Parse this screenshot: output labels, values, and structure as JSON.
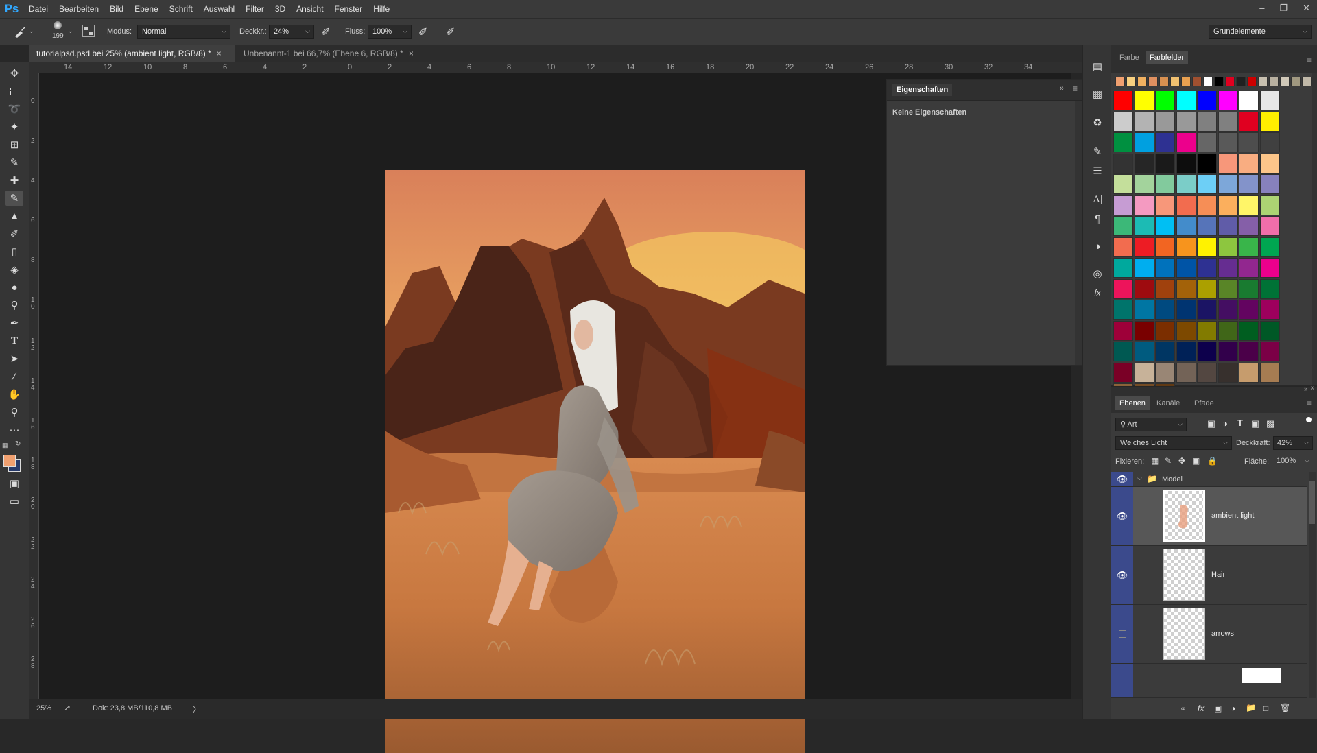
{
  "app": {
    "logo": "Ps"
  },
  "menu": [
    "Datei",
    "Bearbeiten",
    "Bild",
    "Ebene",
    "Schrift",
    "Auswahl",
    "Filter",
    "3D",
    "Ansicht",
    "Fenster",
    "Hilfe"
  ],
  "options": {
    "brush_size": "199",
    "mode_label": "Modus:",
    "mode_value": "Normal",
    "opacity_label": "Deckkr.:",
    "opacity_value": "24%",
    "flow_label": "Fluss:",
    "flow_value": "100%",
    "workspace": "Grundelemente"
  },
  "tabs": [
    {
      "label": "tutorialpsd.psd bei 25% (ambient light, RGB/8) *",
      "close": "×"
    },
    {
      "label": "Unbenannt-1 bei 66,7% (Ebene 6, RGB/8) *",
      "close": "×"
    }
  ],
  "ruler_h": [
    "14",
    "12",
    "10",
    "8",
    "6",
    "4",
    "2",
    "0",
    "2",
    "4",
    "6",
    "8",
    "10",
    "12",
    "14",
    "16",
    "18",
    "20",
    "22",
    "24",
    "26",
    "28",
    "30",
    "32",
    "34"
  ],
  "ruler_v": [
    "0",
    "2",
    "4",
    "6",
    "8",
    "10",
    "12",
    "14",
    "16",
    "18",
    "20",
    "22",
    "24",
    "26",
    "28"
  ],
  "status": {
    "zoom": "25%",
    "doc": "Dok: 23,8 MB/110,8 MB",
    "arrow": "〉"
  },
  "properties": {
    "title": "Eigenschaften",
    "empty": "Keine Eigenschaften"
  },
  "swatches": {
    "tab_color": "Farbe",
    "tab_swatches": "Farbfelder",
    "recent": [
      "#f0a070",
      "#f8d080",
      "#f0b060",
      "#e09060",
      "#d89050",
      "#f0c070",
      "#e8a050",
      "#a05030",
      "#ffffff",
      "#000000",
      "#e00020",
      "#202020",
      "#cc0000",
      "#c8c0b0",
      "#b8b0a0",
      "#d0c8b8",
      "#a09880",
      "#c0b8a8"
    ],
    "grid": [
      [
        "#ff0000",
        "#ffff00",
        "#00ff00",
        "#00ffff",
        "#0000ff",
        "#ff00ff",
        "#ffffff",
        "#e6e6e6"
      ],
      [
        "#cccccc",
        "#b3b3b3",
        "#999999",
        "#999999",
        "#808080",
        "#808080",
        "#e00020",
        "#ffee00"
      ],
      [
        "#009040",
        "#00a0e0",
        "#2e3192",
        "#ec008c",
        "#666666",
        "#595959",
        "#4d4d4d",
        "#404040"
      ],
      [
        "#333333",
        "#262626",
        "#1a1a1a",
        "#0d0d0d",
        "#000000",
        "#f7977a",
        "#f9ad81",
        "#fdc68a"
      ],
      [
        "#c4df9b",
        "#a3d39c",
        "#82ca9d",
        "#7bcdc8",
        "#6dcff6",
        "#7da7d9",
        "#8393ca",
        "#8781bd"
      ],
      [
        "#c69cd3",
        "#f49ac1",
        "#f7977a",
        "#f26c4f",
        "#f68e56",
        "#fbaf5d",
        "#fff568",
        "#acd373"
      ],
      [
        "#3cb878",
        "#1cbbb4",
        "#00bff3",
        "#438ccb",
        "#5674b9",
        "#605ca8",
        "#855fa8",
        "#f06eaa"
      ],
      [
        "#f26c4f",
        "#ed1c24",
        "#f26522",
        "#f7941d",
        "#fff200",
        "#8dc63f",
        "#39b54a",
        "#00a651"
      ],
      [
        "#00a99d",
        "#00aeef",
        "#0072bc",
        "#0054a6",
        "#2e3192",
        "#662d91",
        "#92278f",
        "#ec008c"
      ],
      [
        "#ed145b",
        "#9e0b0f",
        "#a0410d",
        "#a36209",
        "#aba000",
        "#598527",
        "#197b30",
        "#007236"
      ],
      [
        "#00746b",
        "#0076a3",
        "#004a80",
        "#003471",
        "#1b1464",
        "#440e62",
        "#630460",
        "#9e005d"
      ],
      [
        "#9e0039",
        "#790000",
        "#7b2e00",
        "#7d4900",
        "#827b00",
        "#406618",
        "#005e20",
        "#005826"
      ],
      [
        "#005952",
        "#005b7f",
        "#003663",
        "#002157",
        "#0d004c",
        "#32004b",
        "#4b0049",
        "#7b0046"
      ],
      [
        "#7a0026",
        "#c7b299",
        "#998675",
        "#736357",
        "#534741",
        "#37302d",
        "#c69c6d",
        "#a67c52"
      ],
      [
        "#8c6239",
        "#754c24",
        "#603913"
      ]
    ]
  },
  "layers": {
    "tab_layers": "Ebenen",
    "tab_channels": "Kanäle",
    "tab_paths": "Pfade",
    "filter_label": "Art",
    "blend_mode": "Weiches Licht",
    "opacity_label": "Deckkraft:",
    "opacity_value": "42%",
    "lock_label": "Fixieren:",
    "fill_label": "Fläche:",
    "fill_value": "100%",
    "group": {
      "name": "Model"
    },
    "items": [
      {
        "name": "ambient light"
      },
      {
        "name": "Hair"
      },
      {
        "name": "arrows"
      }
    ]
  }
}
